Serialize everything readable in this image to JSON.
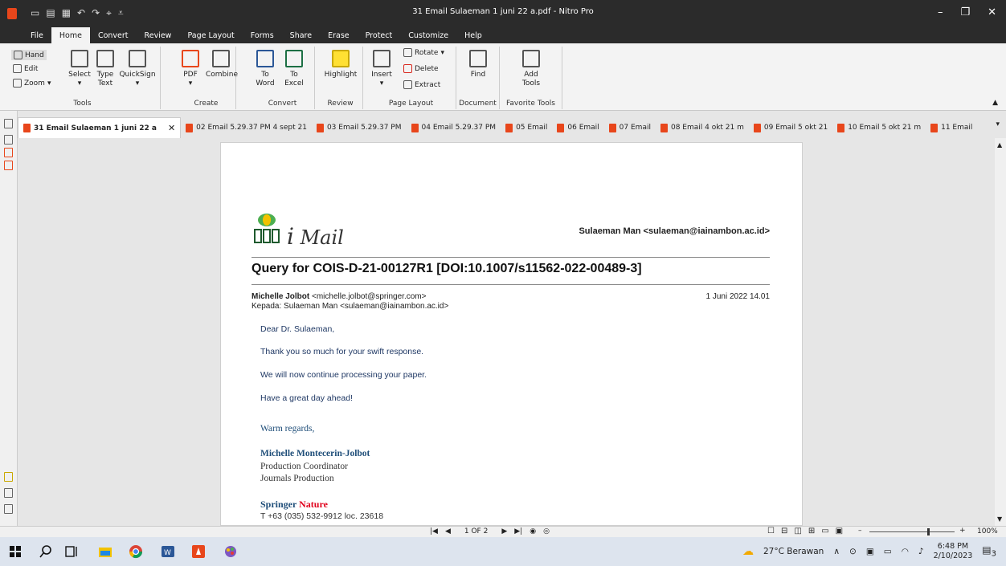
{
  "window": {
    "title": "31 Email Sulaeman 1 juni 22 a.pdf - Nitro Pro"
  },
  "menu": [
    "File",
    "Home",
    "Convert",
    "Review",
    "Page Layout",
    "Forms",
    "Share",
    "Erase",
    "Protect",
    "Customize",
    "Help"
  ],
  "ribbon": {
    "tools": {
      "hand": "Hand",
      "edit": "Edit",
      "zoom": "Zoom",
      "select": "Select",
      "type_text_1": "Type",
      "type_text_2": "Text",
      "quicksign": "QuickSign",
      "label": "Tools"
    },
    "create": {
      "pdf": "PDF",
      "combine": "Combine",
      "label": "Create"
    },
    "convert": {
      "to_word_1": "To",
      "to_word_2": "Word",
      "to_excel_1": "To",
      "to_excel_2": "Excel",
      "label": "Convert"
    },
    "review": {
      "highlight": "Highlight",
      "label": "Review"
    },
    "page_layout": {
      "insert": "Insert",
      "rotate": "Rotate",
      "delete": "Delete",
      "extract": "Extract",
      "label": "Page Layout"
    },
    "document": {
      "find": "Find",
      "label": "Document"
    },
    "favorite": {
      "add_1": "Add",
      "add_2": "Tools",
      "label": "Favorite Tools"
    }
  },
  "tabs": [
    "31 Email Sulaeman 1 juni 22 a",
    "02 Email 5.29.37 PM 4 sept 21",
    "03 Email 5.29.37 PM",
    "04 Email 5.29.37 PM",
    "05 Email",
    "06 Email",
    "07 Email",
    "08 Email 4 okt 21 m",
    "09 Email 5 okt 21",
    "10 Email 5 okt 21 m",
    "11 Email"
  ],
  "email": {
    "brand_word": "Mail",
    "header_sender": "Sulaeman Man <sulaeman@iainambon.ac.id>",
    "subject": "Query for COIS-D-21-00127R1 [DOI:10.1007/s11562-022-00489-3]",
    "from_name": "Michelle Jolbot",
    "from_addr": "<michelle.jolbot@springer.com>",
    "to_line": "Kepada: Sulaeman Man <sulaeman@iainambon.ac.id>",
    "date": "1 Juni 2022 14.01",
    "body": [
      "Dear Dr. Sulaeman,",
      "Thank you so much for your swift response.",
      "We will now continue processing your paper.",
      "Have a great day ahead!"
    ],
    "regards": "Warm regards,",
    "sig_name": "Michelle Montecerin-Jolbot",
    "sig_title": "Production Coordinator",
    "sig_dept": "Journals Production",
    "springer_1": "Springer",
    "springer_2": "Nature",
    "phone": "T +63 (035) 532-9912 loc. 23618"
  },
  "status": {
    "page": "1 OF 2",
    "zoom": "100%",
    "zoom_level": 0.68
  },
  "taskbar": {
    "weather": "27°C Berawan",
    "time": "6:48 PM",
    "date": "2/10/2023",
    "notifications": "3"
  }
}
